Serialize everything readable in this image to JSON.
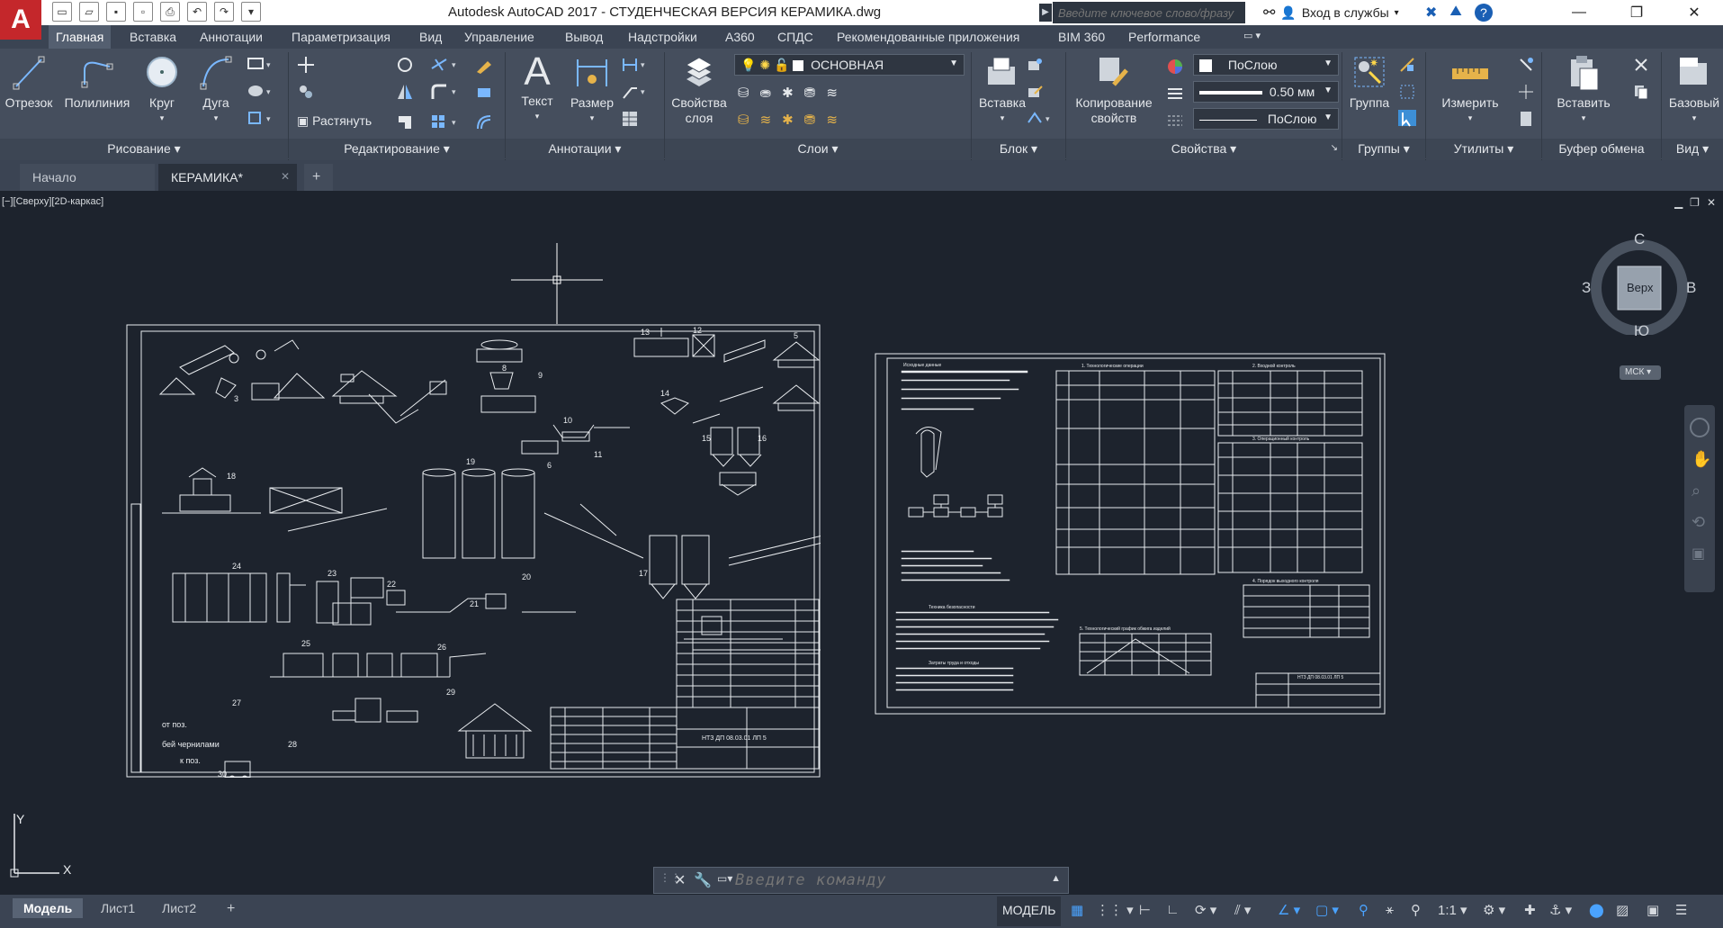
{
  "title_bar": {
    "logo": "A",
    "title": "Autodesk AutoCAD 2017 - СТУДЕНЧЕСКАЯ ВЕРСИЯ    КЕРАМИКА.dwg",
    "search_placeholder": "Введите ключевое слово/фразу",
    "signin": "Вход в службы",
    "win_minimize": "—",
    "win_maximize": "❐",
    "win_close": "✕"
  },
  "ribbon_tabs": [
    "Главная",
    "Вставка",
    "Аннотации",
    "Параметризация",
    "Вид",
    "Управление",
    "Вывод",
    "Надстройки",
    "A360",
    "СПДС",
    "Рекомендованные приложения",
    "BIM 360",
    "Performance"
  ],
  "ribbon": {
    "draw": {
      "label": "Рисование",
      "line": "Отрезок",
      "polyline": "Полилиния",
      "circle": "Круг",
      "arc": "Дуга"
    },
    "modify": {
      "label": "Редактирование",
      "stretch": "Растянуть"
    },
    "annotation": {
      "label": "Аннотации",
      "text": "Текст",
      "text_glyph": "A",
      "dimension": "Размер"
    },
    "layers": {
      "label": "Слои",
      "properties_line1": "Свойства",
      "properties_line2": "слоя",
      "current_layer": "ОСНОВНАЯ"
    },
    "block": {
      "label": "Блок",
      "insert": "Вставка"
    },
    "properties": {
      "label": "Свойства",
      "match_line1": "Копирование",
      "match_line2": "свойств",
      "color": "ПоСлою",
      "lineweight": "0.50 мм",
      "linetype": "ПоСлою"
    },
    "groups": {
      "label": "Группы",
      "group": "Группа"
    },
    "utilities": {
      "label": "Утилиты",
      "measure": "Измерить"
    },
    "clipboard": {
      "label": "Буфер обмена",
      "paste": "Вставить"
    },
    "view": {
      "label": "Вид",
      "base": "Базовый"
    }
  },
  "doc_tabs": [
    "Начало",
    "КЕРАМИКА*"
  ],
  "viewport": {
    "label": "[−][Сверху][2D-каркас]",
    "viewcube": {
      "north": "С",
      "south": "Ю",
      "west": "З",
      "east": "В",
      "face": "Верх",
      "ucs": "МСК"
    },
    "axis_y": "Y",
    "axis_x": "X"
  },
  "command_line": {
    "placeholder": "Введите команду"
  },
  "layout_tabs": [
    "Модель",
    "Лист1",
    "Лист2"
  ],
  "status": {
    "mode": "МОДЕЛЬ",
    "scale": "1:1"
  },
  "drawing_labels": {
    "sheet1_title": "НТЗ ДП 08.03.01 ЛП 5",
    "sheet2_title": "НТЗ ДП 08.03.01 ЛП 5",
    "note1": "от поз.",
    "note2": "бей чернилами",
    "note3": "к поз.",
    "pos1": "3",
    "pos2": "13",
    "pos3": "12",
    "pos4": "11",
    "pos5": "5",
    "pos6": "8",
    "pos7": "9",
    "pos8": "10",
    "pos9": "14",
    "pos10": "15",
    "pos11": "16",
    "pos12": "18",
    "pos13": "19",
    "pos14": "6",
    "pos15": "17",
    "pos16": "24",
    "pos17": "23",
    "pos18": "22",
    "pos19": "20",
    "pos20": "21",
    "pos21": "25",
    "pos22": "26",
    "pos23": "27",
    "pos24": "28",
    "pos25": "29",
    "pos26": "30",
    "s2_title1": "Исходные данные",
    "s2_title2": "1. Технологические операции",
    "s2_title3": "2. Входной контроль",
    "s2_title4": "3. Операционный контроль",
    "s2_title5": "4. Порядок выходного контроля",
    "s2_title6": "Техника безопасности",
    "s2_title7": "Затраты труда и отходы",
    "s2_title8": "5. Технологический график обжига изделий"
  }
}
